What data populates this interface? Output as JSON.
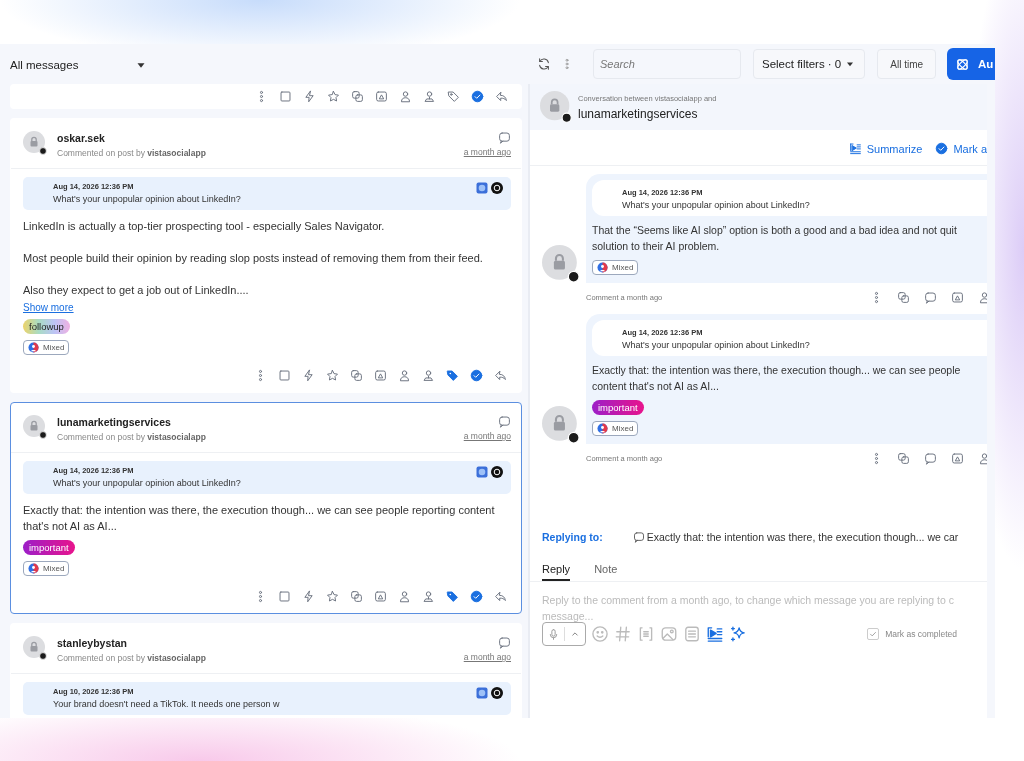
{
  "topbar": {
    "view": "All messages",
    "search": {
      "placeholder": "Search"
    },
    "filters": "Select filters · 0",
    "time": "All time",
    "auto_button": "Au"
  },
  "top_actions": {
    "tagged": false,
    "completed": true
  },
  "messages": [
    {
      "author": "oskar.sek",
      "meta": "Commented on post by **vistasocialapp**",
      "time": "a month ago",
      "post_date": "Aug 14, 2026 12:36 PM",
      "post_title": "What's your unpopular opinion about LinkedIn?",
      "body": [
        "LinkedIn is actually a top-tier prospecting tool - especially Sales Navigator.",
        "Most people build their opinion by reading slop posts instead of removing them from their feed.",
        "Also they expect to get a job out of LinkedIn...."
      ],
      "show_more": "Show more",
      "tags": [
        {
          "label": "followup",
          "kind": "rainbow"
        }
      ],
      "sentiment": "Mixed",
      "tagged": true,
      "completed": true,
      "selected": false
    },
    {
      "author": "lunamarketingservices",
      "meta": "Commented on post by **vistasocialapp**",
      "time": "a month ago",
      "post_date": "Aug 14, 2026 12:36 PM",
      "post_title": "What's your unpopular opinion about LinkedIn?",
      "body": [
        "Exactly that: the intention was there, the execution though... we can see people reporting content that's not AI as AI..."
      ],
      "tags": [
        {
          "label": "important",
          "kind": "magenta"
        }
      ],
      "sentiment": "Mixed",
      "tagged": true,
      "completed": true,
      "selected": true
    },
    {
      "author": "stanleybystan",
      "meta": "Commented on post by **vistasocialapp**",
      "time": "a month ago",
      "post_date": "Aug 10, 2026 12:36 PM",
      "post_title": "Your brand doesn't need a TikTok. It needs one person w",
      "selected": false
    }
  ],
  "conversation": {
    "caption": "Conversation between vistasocialapp and",
    "name": "lunamarketingservices",
    "summarize": "Summarize",
    "mark": "Mark a",
    "comments": [
      {
        "post_date": "Aug 14, 2026 12:36 PM",
        "post_title": "What's your unpopular opinion about LinkedIn?",
        "body": "That the “Seems like AI slop” option is both a good and a bad idea and not quit solution to their AI problem.",
        "sentiment": "Mixed",
        "footer": "Comment a month ago"
      },
      {
        "post_date": "Aug 14, 2026 12:36 PM",
        "post_title": "What's your unpopular opinion about LinkedIn?",
        "body": "Exactly that: the intention was there, the execution though... we can see people content that's not AI as AI...",
        "tags": [
          {
            "label": "important",
            "kind": "magenta"
          }
        ],
        "sentiment": "Mixed",
        "footer": "Comment a month ago"
      }
    ],
    "replying_label": "Replying to:",
    "replying_text": "Exactly that: the intention was there, the execution though... we car",
    "tabs": [
      {
        "label": "Reply",
        "selected": true
      },
      {
        "label": "Note",
        "selected": false
      }
    ],
    "composer": {
      "placeholder": "Reply to the comment from a month ago, to change which message you are replying to c message..."
    },
    "mark_completed": {
      "label": "Mark as completed",
      "checked": true
    }
  }
}
